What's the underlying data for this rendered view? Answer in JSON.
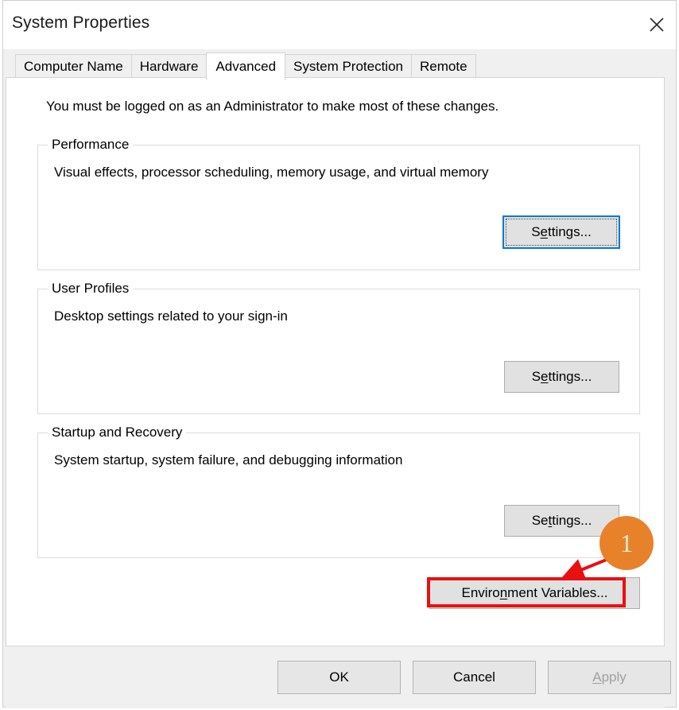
{
  "window": {
    "title": "System Properties",
    "close_icon": "close-icon"
  },
  "tabs": [
    {
      "label": "Computer Name",
      "active": false
    },
    {
      "label": "Hardware",
      "active": false
    },
    {
      "label": "Advanced",
      "active": true
    },
    {
      "label": "System Protection",
      "active": false
    },
    {
      "label": "Remote",
      "active": false
    }
  ],
  "content": {
    "admin_note": "You must be logged on as an Administrator to make most of these changes.",
    "groups": [
      {
        "title": "Performance",
        "description": "Visual effects, processor scheduling, memory usage, and virtual memory",
        "button": {
          "label_pre": "S",
          "label_acc": "e",
          "label_post": "ttings...",
          "full": "Settings...",
          "focused": true
        }
      },
      {
        "title": "User Profiles",
        "description": "Desktop settings related to your sign-in",
        "button": {
          "label_pre": "S",
          "label_acc": "e",
          "label_post": "ttings...",
          "full": "Settings...",
          "focused": false
        }
      },
      {
        "title": "Startup and Recovery",
        "description": "System startup, system failure, and debugging information",
        "button": {
          "label_pre": "Se",
          "label_acc": "t",
          "label_post": "tings...",
          "full": "Settings...",
          "focused": false
        }
      }
    ],
    "env_button": {
      "label_pre": "Enviro",
      "label_acc": "n",
      "label_post": "ment Variables...",
      "full": "Environment Variables..."
    }
  },
  "footer": {
    "ok": "OK",
    "cancel": "Cancel",
    "apply_pre": "",
    "apply_acc": "A",
    "apply_post": "pply",
    "apply_full": "Apply",
    "apply_disabled": true
  },
  "annotations": {
    "step_badge": "1",
    "badge_color": "#e8822a",
    "highlight_color": "#e81010",
    "highlight_target": "Environment Variables..."
  },
  "colors": {
    "accent_focus": "#0078d7",
    "dialog_bg": "#f0f0f0",
    "panel_bg": "#ffffff",
    "button_bg": "#e1e1e1"
  }
}
